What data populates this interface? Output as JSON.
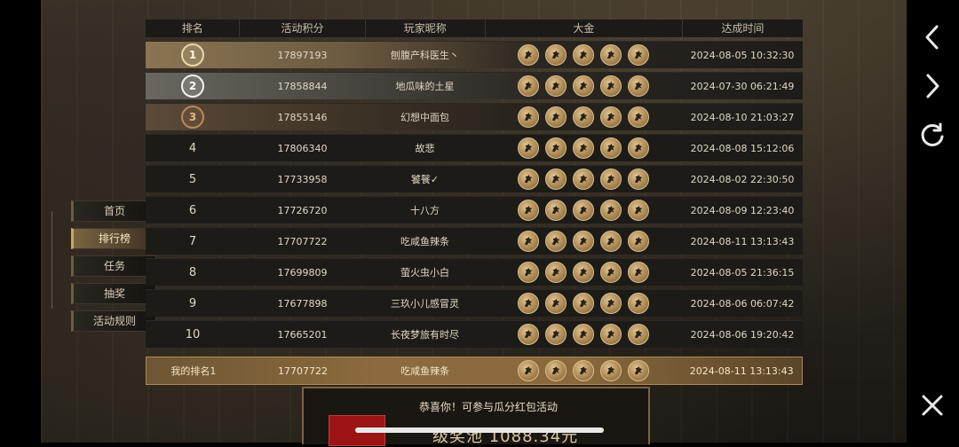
{
  "table": {
    "headers": [
      "排名",
      "活动积分",
      "玩家昵称",
      "大金",
      "达成时间"
    ],
    "rows": [
      {
        "rank": "1",
        "score": "17897193",
        "name": "刨腹产科医生丶",
        "coins": 5,
        "time": "2024-08-05 10:32:30"
      },
      {
        "rank": "2",
        "score": "17858844",
        "name": "地瓜味的土星",
        "coins": 5,
        "time": "2024-07-30 06:21:49"
      },
      {
        "rank": "3",
        "score": "17855146",
        "name": "幻想中面包",
        "coins": 5,
        "time": "2024-08-10 21:03:27"
      },
      {
        "rank": "4",
        "score": "17806340",
        "name": "故悲",
        "coins": 5,
        "time": "2024-08-08 15:12:06"
      },
      {
        "rank": "5",
        "score": "17733958",
        "name": "饕餮✓",
        "coins": 5,
        "time": "2024-08-02 22:30:50"
      },
      {
        "rank": "6",
        "score": "17726720",
        "name": "十八方",
        "coins": 5,
        "time": "2024-08-09 12:23:40"
      },
      {
        "rank": "7",
        "score": "17707722",
        "name": "吃咸鱼辣条",
        "coins": 5,
        "time": "2024-08-11 13:13:43"
      },
      {
        "rank": "8",
        "score": "17699809",
        "name": "萤火虫小白",
        "coins": 5,
        "time": "2024-08-05 21:36:15"
      },
      {
        "rank": "9",
        "score": "17677898",
        "name": "三玖小儿感冒灵",
        "coins": 5,
        "time": "2024-08-06 06:07:42"
      },
      {
        "rank": "10",
        "score": "17665201",
        "name": "长夜梦旅有时尽",
        "coins": 5,
        "time": "2024-08-06 19:20:42"
      }
    ],
    "mine": {
      "rank": "我的排名1",
      "score": "17707722",
      "name": "吃咸鱼辣条",
      "coins": 5,
      "time": "2024-08-11 13:13:43"
    }
  },
  "side_menu": {
    "items": [
      "首页",
      "排行榜",
      "任务",
      "抽奖",
      "活动规则"
    ],
    "active": "排行榜"
  },
  "panel": {
    "congrats": "恭喜你！可参与瓜分红包活动",
    "pool": "级奖池 1088.34元"
  },
  "icons": {
    "back": "chevron-left-icon",
    "forward": "chevron-right-icon",
    "refresh": "refresh-icon",
    "close": "close-icon",
    "coin": "dragon-coin-icon"
  },
  "colors": {
    "accent": "#8b6a3d",
    "coin": "#b6925c",
    "background": "#2a251e"
  }
}
